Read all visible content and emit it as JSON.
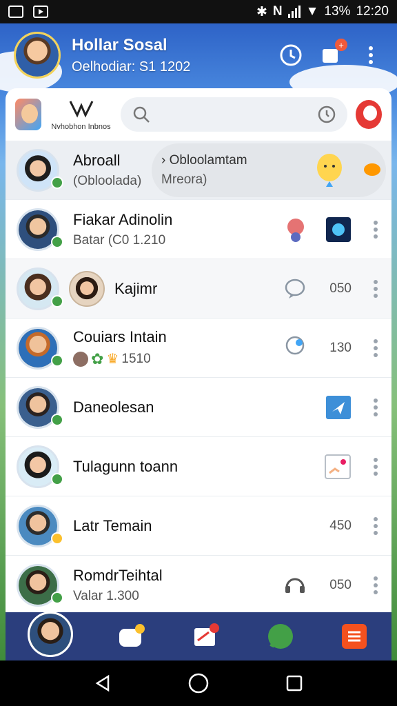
{
  "status_bar": {
    "battery": "13%",
    "time": "12:20"
  },
  "header": {
    "title": "Hollar Sosal",
    "subtitle": "Oelhodiar: S1 1202"
  },
  "toolbar": {
    "brand_sub": "Nvhobhon Inbnos",
    "search_placeholder": ""
  },
  "contacts": [
    {
      "name": "Abroall",
      "sub": "(Obloolada)",
      "extra": "› Obloolamtam",
      "extra2": "Mreora)",
      "status": "online",
      "count": ""
    },
    {
      "name": "Fiakar Adinolin",
      "sub": "Batar (C0 1.210",
      "count": "",
      "status": "online"
    },
    {
      "name": "Kajimr",
      "sub": "",
      "count": "050",
      "status": "online"
    },
    {
      "name": "Couiars Intain",
      "sub": "1510",
      "count": "130",
      "status": "online"
    },
    {
      "name": "Daneolesan",
      "sub": "",
      "count": "",
      "status": "online"
    },
    {
      "name": "Tulagunn toann",
      "sub": "",
      "count": "",
      "status": "online"
    },
    {
      "name": "Latr Temain",
      "sub": "",
      "count": "450",
      "status": "away"
    },
    {
      "name": "RomdrTeihtal",
      "sub": "Valar 1.300",
      "count": "050",
      "status": "online"
    }
  ],
  "colors": {
    "header_bg": "#2e63c7",
    "bottom_bar": "#2b3e7d",
    "online": "#43a047"
  }
}
